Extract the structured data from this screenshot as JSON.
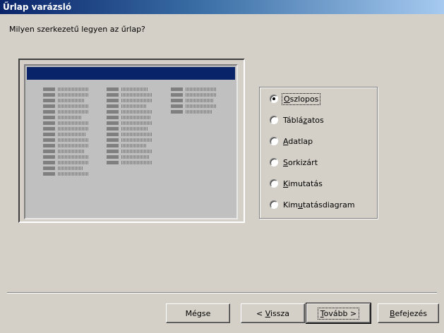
{
  "window": {
    "title": "Űrlap varázsló"
  },
  "prompt": "Milyen szerkezetű legyen az űrlap?",
  "layout_options": [
    {
      "label_pre": "",
      "accel": "O",
      "label_post": "szlopos",
      "selected": true
    },
    {
      "label_pre": "Táblá",
      "accel": "z",
      "label_post": "atos",
      "selected": false
    },
    {
      "label_pre": "",
      "accel": "A",
      "label_post": "datlap",
      "selected": false
    },
    {
      "label_pre": "",
      "accel": "S",
      "label_post": "orkizárt",
      "selected": false
    },
    {
      "label_pre": "",
      "accel": "K",
      "label_post": "imutatás",
      "selected": false
    },
    {
      "label_pre": "Kim",
      "accel": "u",
      "label_post": "tatásdiagram",
      "selected": false
    }
  ],
  "buttons": {
    "cancel": {
      "pre": "Mégse",
      "accel": "",
      "post": ""
    },
    "back": {
      "pre": "< ",
      "accel": "V",
      "post": "issza"
    },
    "next": {
      "pre": "",
      "accel": "T",
      "post": "ovább >"
    },
    "finish": {
      "pre": "",
      "accel": "B",
      "post": "efejezés"
    }
  },
  "colors": {
    "dialog_bg": "#d4d0c8",
    "title_gradient_start": "#0a246a",
    "title_gradient_end": "#a6caf0",
    "preview_header": "#0a246a"
  }
}
